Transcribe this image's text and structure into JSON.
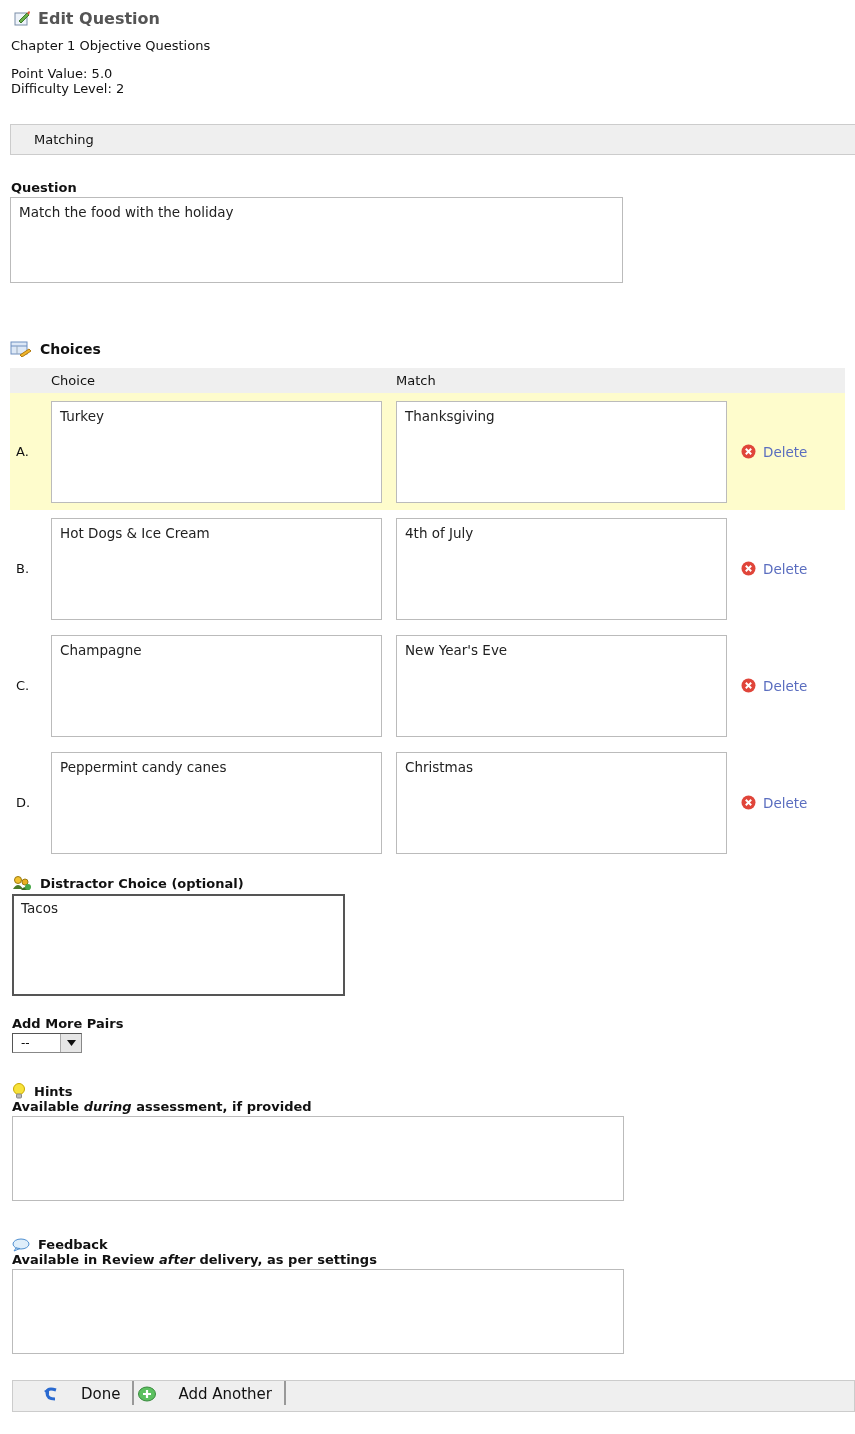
{
  "page": {
    "title": "Edit Question",
    "pool": "Chapter 1 Objective Questions",
    "point_value": "Point Value: 5.0",
    "difficulty": "Difficulty Level: 2"
  },
  "question_type": "Matching",
  "question": {
    "label": "Question",
    "value": "Match the food with the holiday"
  },
  "choices": {
    "heading": "Choices",
    "columns": [
      "Choice",
      "Match"
    ],
    "rows": [
      {
        "letter": "A.",
        "choice": "Turkey",
        "match": "Thanksgiving",
        "delete": "Delete",
        "highlighted": true
      },
      {
        "letter": "B.",
        "choice": "Hot Dogs & Ice Cream",
        "match": "4th of July",
        "delete": "Delete",
        "highlighted": false
      },
      {
        "letter": "C.",
        "choice": "Champagne",
        "match": "New Year's Eve",
        "delete": "Delete",
        "highlighted": false
      },
      {
        "letter": "D.",
        "choice": "Peppermint candy canes",
        "match": "Christmas",
        "delete": "Delete",
        "highlighted": false
      }
    ]
  },
  "distractor": {
    "label": "Distractor Choice (optional)",
    "value": "Tacos"
  },
  "add_more_pairs": {
    "label": "Add More Pairs",
    "value": "--"
  },
  "hints": {
    "label": "Hints",
    "note": "Available *during* assessment, if provided"
  },
  "feedback": {
    "label": "Feedback",
    "note": "Available in Review *after* delivery, as per settings"
  },
  "buttons": [
    {
      "kind": "done",
      "label": "Done"
    },
    {
      "kind": "add",
      "label": "Add Another"
    }
  ]
}
